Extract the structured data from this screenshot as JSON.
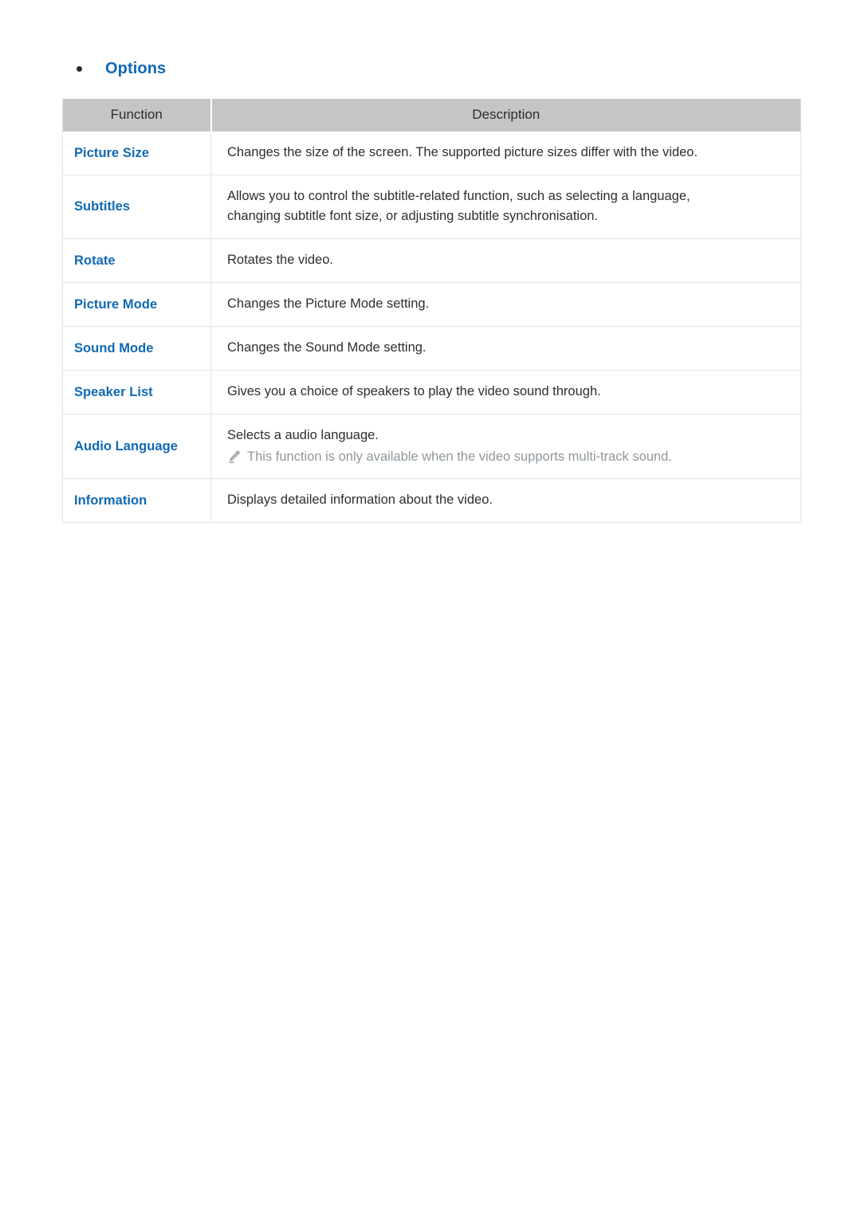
{
  "section": {
    "bullet_label": "Options"
  },
  "table": {
    "headers": {
      "function": "Function",
      "description": "Description"
    },
    "rows": [
      {
        "function": "Picture Size",
        "description_lines": [
          "Changes the size of the screen. The supported picture sizes differ with the video."
        ],
        "note": null
      },
      {
        "function": "Subtitles",
        "description_lines": [
          "Allows you to control the subtitle-related function, such as selecting a language,",
          "changing subtitle font size, or adjusting subtitle synchronisation."
        ],
        "note": null
      },
      {
        "function": "Rotate",
        "description_lines": [
          "Rotates the video."
        ],
        "note": null
      },
      {
        "function": "Picture Mode",
        "description_lines": [
          "Changes the Picture Mode setting."
        ],
        "note": null
      },
      {
        "function": "Sound Mode",
        "description_lines": [
          "Changes the Sound Mode setting."
        ],
        "note": null
      },
      {
        "function": "Speaker List",
        "description_lines": [
          "Gives you a choice of speakers to play the video sound through."
        ],
        "note": null
      },
      {
        "function": "Audio Language",
        "description_lines": [
          "Selects a audio language."
        ],
        "note": "This function is only available when the video supports multi-track sound.",
        "note_icon": "pencil-note-icon"
      },
      {
        "function": "Information",
        "description_lines": [
          "Displays detailed information about the video."
        ],
        "note": null
      }
    ]
  },
  "colors": {
    "accent_blue": "#1069b4",
    "header_bg": "#c3c5c7",
    "body_text": "#2e2e2e",
    "note_text": "#8e979d",
    "border": "#e4e5e7",
    "page_bg": "#ffffff"
  }
}
